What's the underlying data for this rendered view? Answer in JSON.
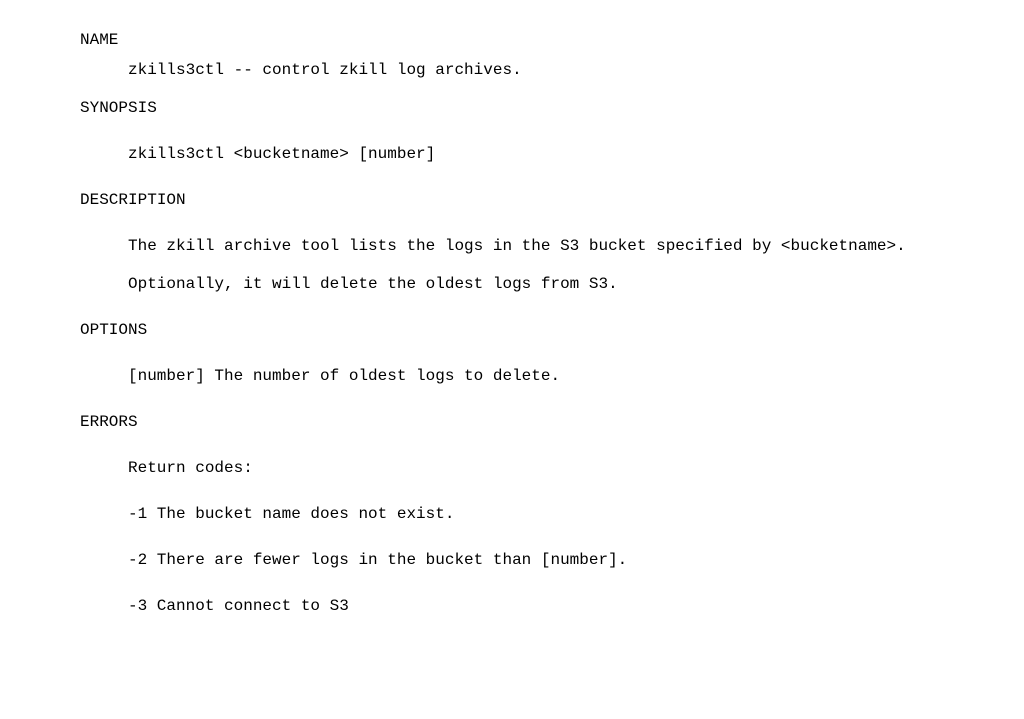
{
  "sections": {
    "name": {
      "heading": "NAME",
      "line": "zkills3ctl -- control zkill log archives."
    },
    "synopsis": {
      "heading": "SYNOPSIS",
      "line": "zkills3ctl <bucketname> [number]"
    },
    "description": {
      "heading": "DESCRIPTION",
      "para1": "The zkill archive tool lists the logs in the S3 bucket specified by <bucketname>.",
      "para2": "Optionally, it will delete the oldest logs from S3."
    },
    "options": {
      "heading": "OPTIONS",
      "line": "[number] The number of oldest logs to delete."
    },
    "errors": {
      "heading": "ERRORS",
      "intro": "Return codes:",
      "codes": {
        "c1": "-1 The bucket name does not exist.",
        "c2": "-2 There are fewer logs in the bucket than [number].",
        "c3": "-3 Cannot connect to S3"
      }
    }
  }
}
